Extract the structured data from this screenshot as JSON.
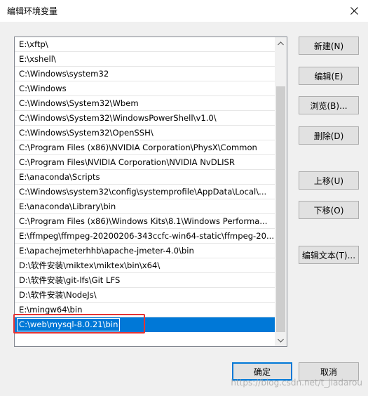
{
  "window": {
    "title": "编辑环境变量"
  },
  "path_list": {
    "items": [
      "E:\\xftp\\",
      "E:\\xshell\\",
      "C:\\Windows\\system32",
      "C:\\Windows",
      "C:\\Windows\\System32\\Wbem",
      "C:\\Windows\\System32\\WindowsPowerShell\\v1.0\\",
      "C:\\Windows\\System32\\OpenSSH\\",
      "C:\\Program Files (x86)\\NVIDIA Corporation\\PhysX\\Common",
      "C:\\Program Files\\NVIDIA Corporation\\NVIDIA NvDLISR",
      "E:\\anaconda\\Scripts",
      "C:\\Windows\\system32\\config\\systemprofile\\AppData\\Local\\...",
      "E:\\anaconda\\Library\\bin",
      "C:\\Program Files (x86)\\Windows Kits\\8.1\\Windows Performa...",
      "E:\\ffmpeg\\ffmpeg-20200206-343ccfc-win64-static\\ffmpeg-20...",
      "E:\\apachejmeterhhb\\apache-jmeter-4.0\\bin",
      "D:\\软件安装\\miktex\\miktex\\bin\\x64\\",
      "D:\\软件安装\\git-lfs\\Git LFS",
      "D:\\软件安装\\NodeJs\\",
      "E:\\mingw64\\bin"
    ],
    "editing_value": "C:\\web\\mysql-8.0.21\\bin"
  },
  "buttons": {
    "new": "新建(N)",
    "edit": "编辑(E)",
    "browse": "浏览(B)...",
    "delete": "删除(D)",
    "move_up": "上移(U)",
    "move_down": "下移(O)",
    "edit_text": "编辑文本(T)...",
    "ok": "确定",
    "cancel": "取消"
  },
  "watermark": "https://blog.csdn.net/t_jiadarou",
  "colors": {
    "selection": "#0078d7",
    "highlight_box": "#e53333",
    "dialog_bg": "#f0f0f0"
  },
  "icons": {
    "close": "close-icon",
    "scroll_up": "chevron-up-icon",
    "scroll_down": "chevron-down-icon"
  }
}
